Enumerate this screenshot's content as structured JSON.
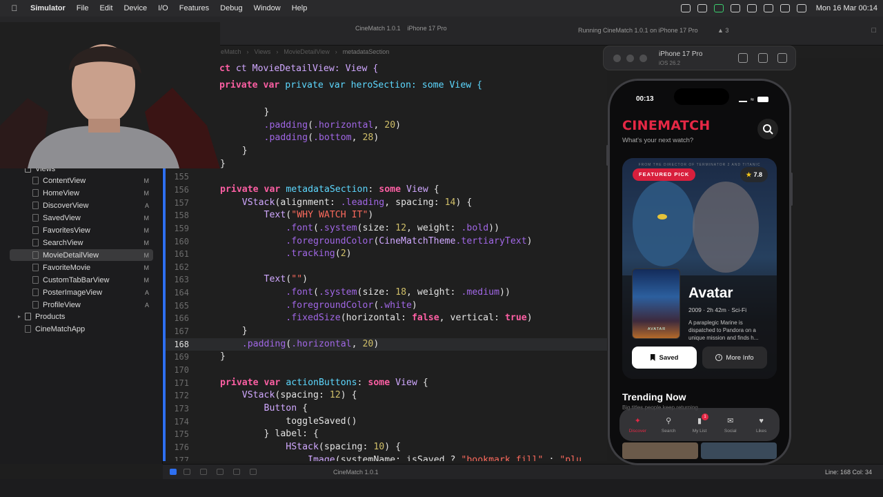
{
  "menubar": {
    "app_name": "Simulator",
    "items": [
      "File",
      "Edit",
      "Device",
      "I/O",
      "Features",
      "Debug",
      "Window",
      "Help"
    ],
    "clock": "Mon 16 Mar  00:14"
  },
  "toolbar": {
    "scheme": "CineMatch 1.0.1",
    "destination": "iPhone 17 Pro",
    "status": "Running CineMatch 1.0.1 on iPhone 17 Pro",
    "warnings": "3"
  },
  "jumpbar": {
    "crumbs": [
      "eMatch",
      "Views",
      "MovieDetailView",
      "metadataSection"
    ]
  },
  "navigator": {
    "group_label": "Views",
    "files": [
      {
        "name": "ContentView",
        "badge": "M"
      },
      {
        "name": "HomeView",
        "badge": "M"
      },
      {
        "name": "DiscoverView",
        "badge": "A"
      },
      {
        "name": "SavedView",
        "badge": "M"
      },
      {
        "name": "FavoritesView",
        "badge": "M"
      },
      {
        "name": "SearchView",
        "badge": "M"
      },
      {
        "name": "MovieDetailView",
        "badge": "M"
      },
      {
        "name": "FavoriteMovie",
        "badge": "M"
      },
      {
        "name": "CustomTabBarView",
        "badge": "M"
      },
      {
        "name": "PosterImageView",
        "badge": "A"
      },
      {
        "name": "ProfileView",
        "badge": "A"
      }
    ],
    "products": "Products",
    "app": "CineMatchApp"
  },
  "editor": {
    "sticky_1": "ct MovieDetailView: View {",
    "sticky_2": "private var heroSection: some View {",
    "lines": [
      {
        "n": "",
        "code": "        }"
      },
      {
        "n": "",
        "code": "        .padding(.horizontal, 20)"
      },
      {
        "n": "",
        "code": "        .padding(.bottom, 28)"
      },
      {
        "n": "",
        "code": "    }"
      },
      {
        "n": "",
        "code": "}"
      },
      {
        "n": "155",
        "code": ""
      },
      {
        "n": "156",
        "code": "private var metadataSection: some View {"
      },
      {
        "n": "157",
        "code": "    VStack(alignment: .leading, spacing: 14) {"
      },
      {
        "n": "158",
        "code": "        Text(\"WHY WATCH IT\")"
      },
      {
        "n": "159",
        "code": "            .font(.system(size: 12, weight: .bold))"
      },
      {
        "n": "160",
        "code": "            .foregroundColor(CineMatchTheme.tertiaryText)"
      },
      {
        "n": "161",
        "code": "            .tracking(2)"
      },
      {
        "n": "162",
        "code": ""
      },
      {
        "n": "163",
        "code": "        Text(\"\")"
      },
      {
        "n": "164",
        "code": "            .font(.system(size: 18, weight: .medium))"
      },
      {
        "n": "165",
        "code": "            .foregroundColor(.white)"
      },
      {
        "n": "166",
        "code": "            .fixedSize(horizontal: false, vertical: true)"
      },
      {
        "n": "167",
        "code": "    }"
      },
      {
        "n": "168",
        "code": "    .padding(.horizontal, 20)"
      },
      {
        "n": "169",
        "code": "}"
      },
      {
        "n": "170",
        "code": ""
      },
      {
        "n": "171",
        "code": "private var actionButtons: some View {"
      },
      {
        "n": "172",
        "code": "    VStack(spacing: 12) {"
      },
      {
        "n": "173",
        "code": "        Button {"
      },
      {
        "n": "174",
        "code": "            toggleSaved()"
      },
      {
        "n": "175",
        "code": "        } label: {"
      },
      {
        "n": "176",
        "code": "            HStack(spacing: 10) {"
      },
      {
        "n": "177",
        "code": "                Image(systemName: isSaved ? \"bookmark.fill\" : \"plu"
      }
    ]
  },
  "statusbar": {
    "run_target": "CineMatch 1.0.1",
    "cursor": "Line: 168  Col: 34"
  },
  "simulator": {
    "device": "iPhone 17 Pro",
    "os": "iOS 26.2"
  },
  "app": {
    "time": "00:13",
    "brand": "CINEMATCH",
    "tagline": "What's your next watch?",
    "hero_tag": "FROM THE DIRECTOR OF TERMINATOR 2 AND TITANIC",
    "featured": "FEATURED PICK",
    "rating": "7.8",
    "poster_label": "AVATAR",
    "title": "Avatar",
    "meta": "2009 · 2h 42m · Sci-Fi",
    "description": "A paraplegic Marine is dispatched to Pandora on a unique mission and finds h...",
    "saved_label": "Saved",
    "info_label": "More Info",
    "trending_title": "Trending Now",
    "trending_sub": "Big titles people keep returning",
    "tabs": [
      {
        "label": "Discover",
        "icon": "sparkle-icon"
      },
      {
        "label": "Search",
        "icon": "search-icon"
      },
      {
        "label": "My List",
        "icon": "bookmark-icon",
        "badge": "1"
      },
      {
        "label": "Social",
        "icon": "chat-bubbles-icon"
      },
      {
        "label": "Likes",
        "icon": "heart-icon"
      }
    ]
  },
  "colors": {
    "brand_red": "#e52845",
    "xcode_accent": "#2e6ff0"
  }
}
